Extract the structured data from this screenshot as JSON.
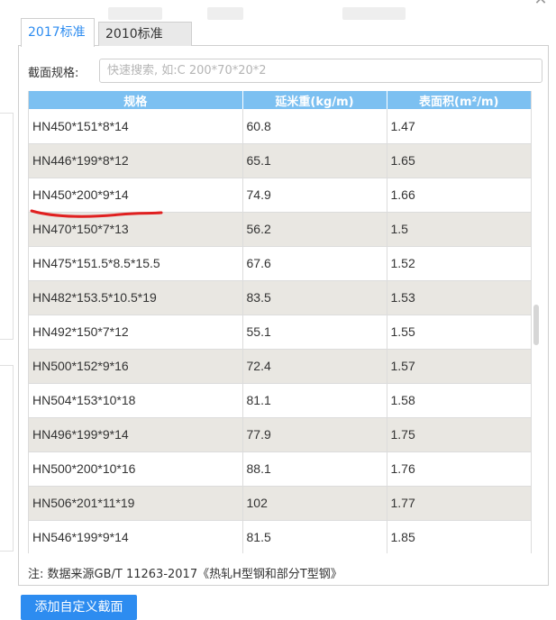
{
  "dialog": {
    "close_glyph": "✕"
  },
  "tabs": [
    {
      "label": "2017标准",
      "active": true
    },
    {
      "label": "2010标准",
      "active": false
    }
  ],
  "search": {
    "label": "截面规格:",
    "placeholder": "快速搜索, 如:C 200*70*20*2",
    "value": ""
  },
  "table": {
    "headers": [
      "规格",
      "延米重(kg/m)",
      "表面积(m²/m)"
    ],
    "rows": [
      [
        "HN450*151*8*14",
        "60.8",
        "1.47"
      ],
      [
        "HN446*199*8*12",
        "65.1",
        "1.65"
      ],
      [
        "HN450*200*9*14",
        "74.9",
        "1.66"
      ],
      [
        "HN470*150*7*13",
        "56.2",
        "1.5"
      ],
      [
        "HN475*151.5*8.5*15.5",
        "67.6",
        "1.52"
      ],
      [
        "HN482*153.5*10.5*19",
        "83.5",
        "1.53"
      ],
      [
        "HN492*150*7*12",
        "55.1",
        "1.55"
      ],
      [
        "HN500*152*9*16",
        "72.4",
        "1.57"
      ],
      [
        "HN504*153*10*18",
        "81.1",
        "1.58"
      ],
      [
        "HN496*199*9*14",
        "77.9",
        "1.75"
      ],
      [
        "HN500*200*10*16",
        "88.1",
        "1.76"
      ],
      [
        "HN506*201*11*19",
        "102",
        "1.77"
      ],
      [
        "HN546*199*9*14",
        "81.5",
        "1.85"
      ]
    ]
  },
  "note": "注: 数据来源GB/T 11263-2017《热轧H型钢和部分T型钢》",
  "footer": {
    "add_button_label": "添加自定义截面"
  },
  "colors": {
    "accent": "#2d8cf0",
    "header_bg": "#7cc0f1",
    "row_alt": "#e9e7e2",
    "annotation": "#e02020"
  }
}
